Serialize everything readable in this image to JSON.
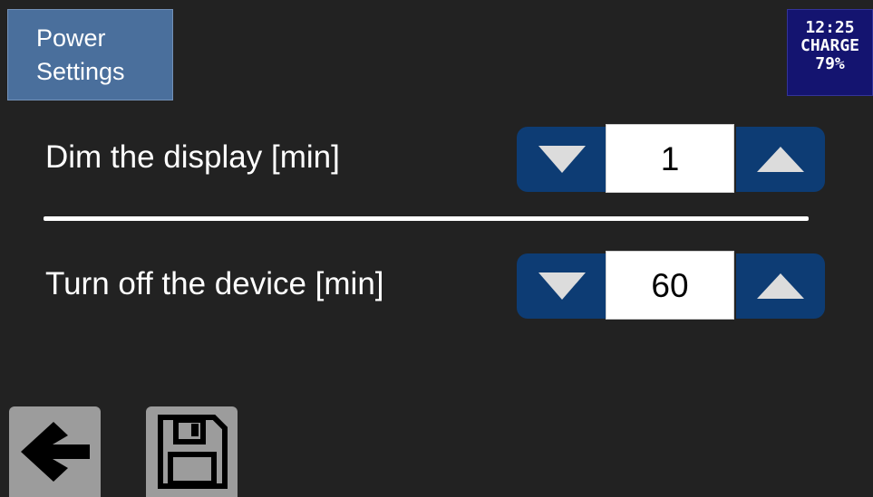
{
  "header": {
    "tab_line1": "Power",
    "tab_line2": "Settings",
    "status": {
      "time": "12:25",
      "state": "CHARGE",
      "battery": "79%"
    }
  },
  "settings": [
    {
      "label": "Dim the display [min]",
      "value": "1"
    },
    {
      "label": "Turn off the device [min]",
      "value": "60"
    }
  ],
  "footer": {
    "back_icon": "arrow-left-icon",
    "save_icon": "floppy-disk-icon"
  },
  "colors": {
    "background": "#222222",
    "tab": "#4a6f9c",
    "status": "#141470",
    "spinner": "#0d3c74",
    "footer_button": "#9c9c9c"
  }
}
